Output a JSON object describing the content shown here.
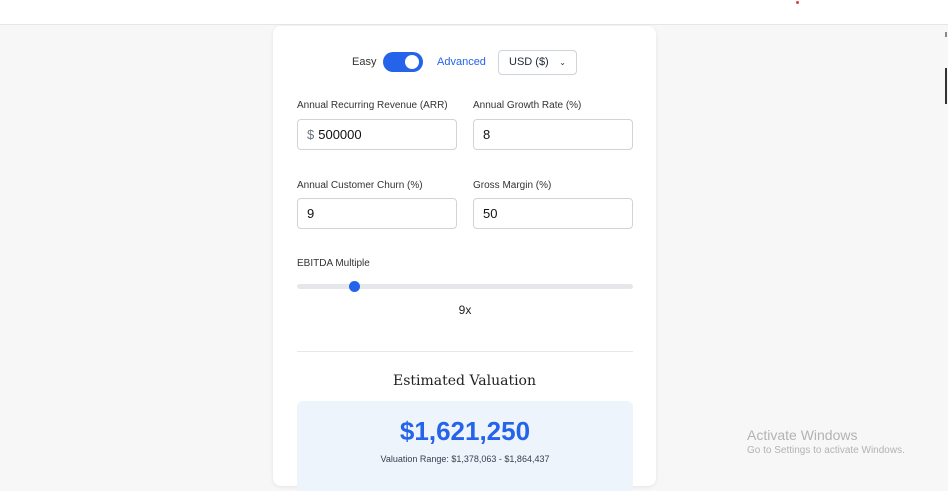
{
  "mode": {
    "easy_label": "Easy",
    "advanced_label": "Advanced",
    "toggle_state": "advanced"
  },
  "currency": {
    "selected": "USD ($)"
  },
  "fields": {
    "arr": {
      "label": "Annual Recurring Revenue (ARR)",
      "prefix": "$",
      "value": "500000"
    },
    "growth": {
      "label": "Annual Growth Rate (%)",
      "value": "8"
    },
    "churn": {
      "label": "Annual Customer Churn (%)",
      "value": "9"
    },
    "margin": {
      "label": "Gross Margin (%)",
      "value": "50"
    }
  },
  "ebitda": {
    "label": "EBITDA Multiple",
    "value_text": "9x",
    "slider_fraction": 0.17
  },
  "result": {
    "title": "Estimated Valuation",
    "value": "$1,621,250",
    "range": "Valuation Range: $1,378,063 - $1,864,437"
  },
  "watermark": {
    "title": "Activate Windows",
    "subtitle": "Go to Settings to activate Windows."
  },
  "colors": {
    "accent": "#2563eb",
    "result_bg": "#eef4fc"
  }
}
